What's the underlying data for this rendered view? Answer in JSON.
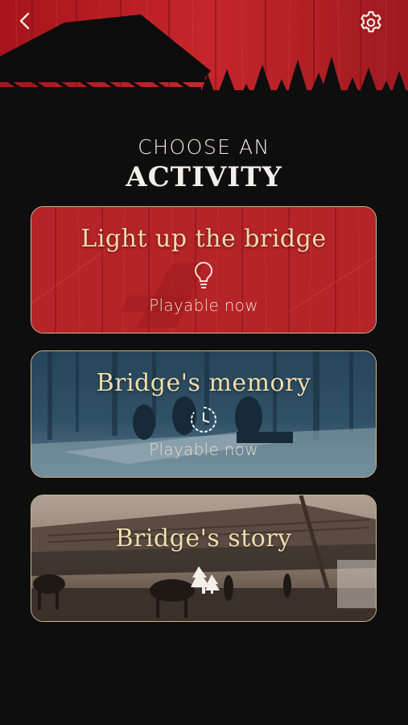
{
  "header": {
    "back_icon": "chevron-left-icon",
    "settings_icon": "gear-icon"
  },
  "heading": {
    "line1": "CHOOSE AN",
    "line2": "ACTIVITY"
  },
  "activities": [
    {
      "title": "Light up the bridge",
      "icon": "lightbulb-icon",
      "status": "Playable now"
    },
    {
      "title": "Bridge's memory",
      "icon": "clock-icon",
      "status": "Playable now"
    },
    {
      "title": "Bridge's story",
      "icon": "trees-icon",
      "status": ""
    }
  ],
  "colors": {
    "accent_red": "#b3262b",
    "card_border": "#c9b68d",
    "title_text": "#efdcae",
    "background": "#0f0e0e"
  }
}
